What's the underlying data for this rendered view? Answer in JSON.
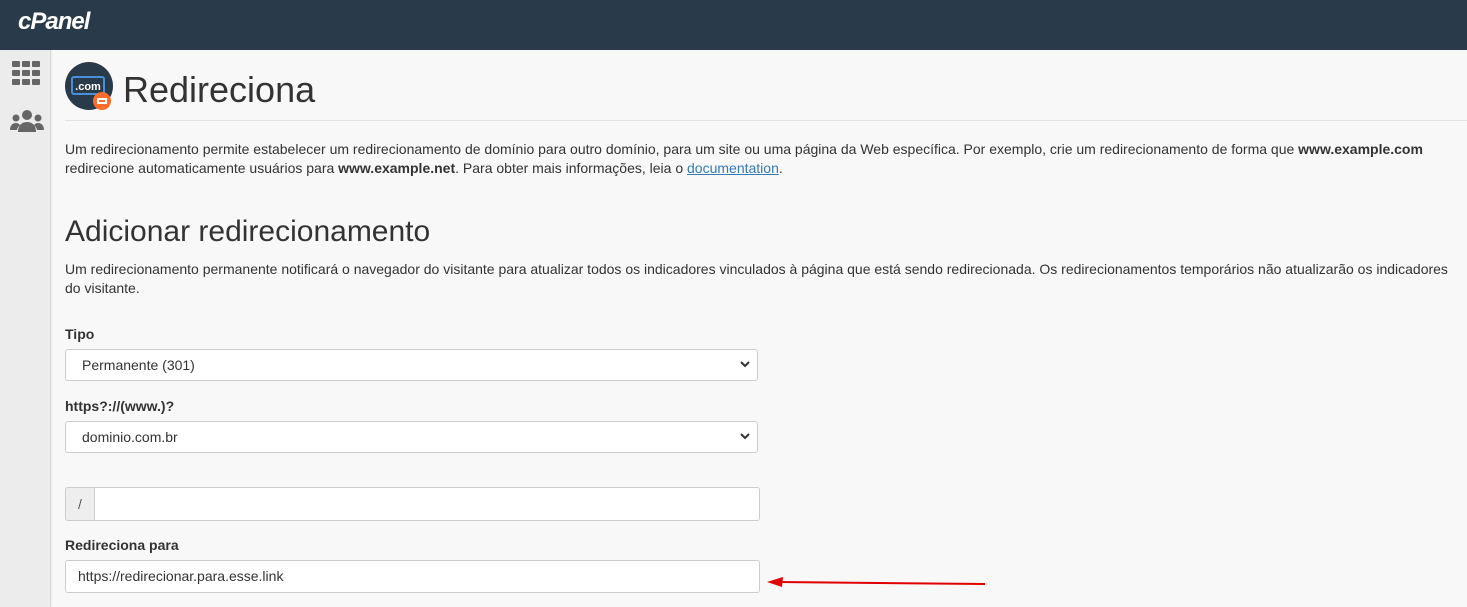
{
  "app": {
    "logo": "cPanel"
  },
  "sidebar": {
    "items": [
      {
        "icon": "grid-icon"
      },
      {
        "icon": "users-icon"
      }
    ]
  },
  "page": {
    "title": "Redireciona",
    "icon_text": ".com",
    "description": {
      "p1": "Um redirecionamento permite estabelecer um redirecionamento de domínio para outro domínio, para um site ou uma página da Web específica. Por exemplo, crie um redirecionamento de forma que ",
      "b1": "www.example.com",
      "p2": " redirecione automaticamente usuários para ",
      "b2": "www.example.net",
      "p3": ". Para obter mais informações, leia o ",
      "link": "documentation",
      "p4": "."
    }
  },
  "section": {
    "title": "Adicionar redirecionamento",
    "description": "Um redirecionamento permanente notificará o navegador do visitante para atualizar todos os indicadores vinculados à página que está sendo redirecionada. Os redirecionamentos temporários não atualizarão os indicadores do visitante."
  },
  "form": {
    "type_label": "Tipo",
    "type_value": "Permanente (301)",
    "domain_label": "https?://(www.)?",
    "domain_value": "dominio.com.br",
    "path_prefix": "/",
    "path_value": "",
    "redirect_label": "Redireciona para",
    "redirect_value": "https://redirecionar.para.esse.link"
  },
  "colors": {
    "topbar": "#293a4a",
    "accent": "#ff6c2c",
    "annotation_arrow": "#e00000",
    "link": "#337ab7"
  }
}
